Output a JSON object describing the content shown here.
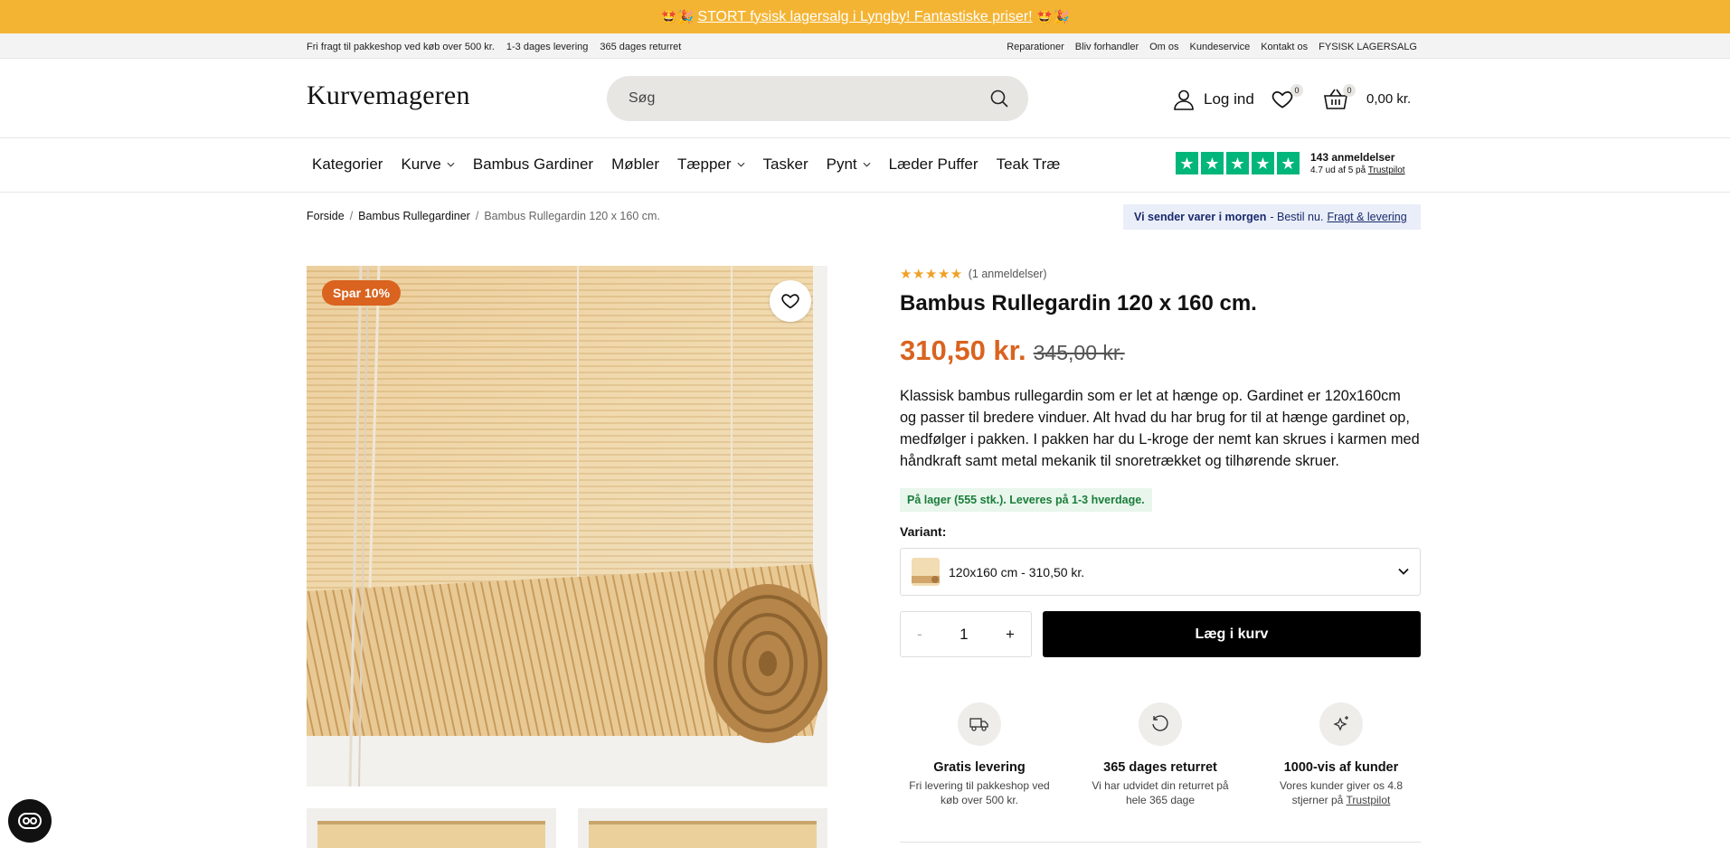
{
  "promo": {
    "emoji_left": "🤩🎉",
    "text": "STORT fysisk lagersalg i Lyngby! Fantastiske priser!",
    "emoji_right": "🤩🎉"
  },
  "util": {
    "left": [
      "Fri fragt til pakkeshop ved køb over 500 kr.",
      "1-3 dages levering",
      "365 dages returret"
    ],
    "right": [
      "Reparationer",
      "Bliv forhandler",
      "Om os",
      "Kundeservice",
      "Kontakt os",
      "FYSISK LAGERSALG"
    ]
  },
  "header": {
    "logo": "Kurvemageren",
    "search_placeholder": "Søg",
    "login": "Log ind",
    "wishlist_count": "0",
    "cart_count": "0",
    "cart_total": "0,00 kr."
  },
  "nav": {
    "items": [
      "Kategorier",
      "Kurve",
      "Bambus Gardiner",
      "Møbler",
      "Tæpper",
      "Tasker",
      "Pynt",
      "Læder Puffer",
      "Teak Træ"
    ],
    "trustpilot": {
      "count": "143 anmeldelser",
      "score": "4.7 ud af 5 på",
      "link": "Trustpilot"
    }
  },
  "breadcrumb": [
    "Forside",
    "Bambus Rullegardiner",
    "Bambus Rullegardin 120 x 160 cm."
  ],
  "shipping_note": {
    "bold": "Vi sender varer i morgen",
    "text": "- Bestil nu.",
    "link": "Fragt & levering"
  },
  "product": {
    "sale_badge": "Spar 10%",
    "stars": "★★★★★",
    "reviews": "(1 anmeldelser)",
    "title": "Bambus Rullegardin 120 x 160 cm.",
    "price": "310,50 kr.",
    "old_price": "345,00 kr.",
    "description": "Klassisk bambus rullegardin som er let at hænge op. Gardinet er 120x160cm og passer til bredere vinduer. Alt hvad du har brug for til at hænge gardinet op, medfølger i pakken. I pakken har du L-kroge der nemt kan skrues i karmen med håndkraft samt metal mekanik til snoretrækket og tilhørende skruer.",
    "stock": "På lager (555 stk.). Leveres på 1-3 hverdage.",
    "variant_label": "Variant:",
    "variant_value": "120x160 cm - 310,50 kr.",
    "qty_minus": "-",
    "qty": "1",
    "qty_plus": "+",
    "add_to_cart": "Læg i kurv"
  },
  "usps": [
    {
      "title": "Gratis levering",
      "desc": "Fri levering til pakkeshop ved køb over 500 kr.",
      "icon": "truck-icon"
    },
    {
      "title": "365 dages returret",
      "desc": "Vi har udvidet din returret på hele 365 dage",
      "icon": "return-icon"
    },
    {
      "title": "1000-vis af kunder",
      "desc": "Vores kunder giver os 4.8 stjerner på",
      "link": "Trustpilot",
      "icon": "sparkle-star-icon"
    }
  ],
  "colors": {
    "promo": "#f4b433",
    "accent": "#d9631f",
    "trustpilot": "#00b67a",
    "stock_bg": "#e8f6ec",
    "stock_text": "#1a7d3a"
  }
}
